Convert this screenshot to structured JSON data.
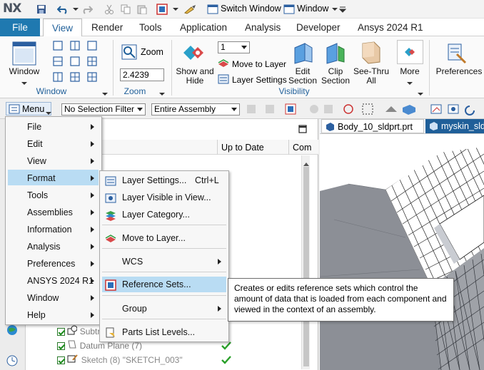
{
  "app": {
    "logo": "NX"
  },
  "qat": {
    "switch_window": "Switch Window",
    "window": "Window"
  },
  "tabs": [
    "File",
    "View",
    "Render",
    "Tools",
    "Application",
    "Analysis",
    "Developer",
    "Ansys 2024 R1"
  ],
  "ribbon": {
    "window_btn": "Window",
    "group_window": "Window",
    "zoom_btn": "Zoom",
    "zoom_value": "2.4239",
    "group_zoom": "Zoom",
    "layer_combo": "1",
    "move_to_layer": "Move to Layer",
    "layer_settings": "Layer Settings",
    "show_hide": "Show and Hide",
    "edit_section": "Edit Section",
    "clip_section": "Clip Section",
    "see_thru": "See-Thru All",
    "more": "More",
    "group_visibility": "Visibility",
    "preferences": "Preferences"
  },
  "cmdbar": {
    "menu": "Menu",
    "selection_filter": "No Selection Filter",
    "assembly_scope": "Entire Assembly"
  },
  "graphics_tabs": [
    "Body_10_sldprt.prt",
    "myskin_sld"
  ],
  "navigator": {
    "col_up_to_date": "Up to Date",
    "col_com": "Com",
    "rows": [
      {
        "label": "Subtr",
        "icon": "subtract-icon"
      },
      {
        "label": "Datum Plane (7)",
        "icon": "datum-plane-icon"
      },
      {
        "label": "Sketch (8) \"SKETCH_003\"",
        "icon": "sketch-icon"
      }
    ]
  },
  "main_menu": [
    "File",
    "Edit",
    "View",
    "Format",
    "Tools",
    "Assemblies",
    "Information",
    "Analysis",
    "Preferences",
    "ANSYS 2024 R1",
    "Window",
    "Help"
  ],
  "format_menu": {
    "layer_settings": "Layer Settings...",
    "layer_settings_shortcut": "Ctrl+L",
    "layer_visible": "Layer Visible in View...",
    "layer_category": "Layer Category...",
    "move_to_layer": "Move to Layer...",
    "wcs": "WCS",
    "reference_sets": "Reference Sets...",
    "group": "Group",
    "parts_list_levels": "Parts List Levels..."
  },
  "tooltip": "Creates or edits reference sets which control the amount of data that is loaded from each component and viewed in the context of an assembly.",
  "colors": {
    "accent": "#1f79b0",
    "highlight": "#b9dcf3",
    "group_label": "#1f5f99"
  }
}
